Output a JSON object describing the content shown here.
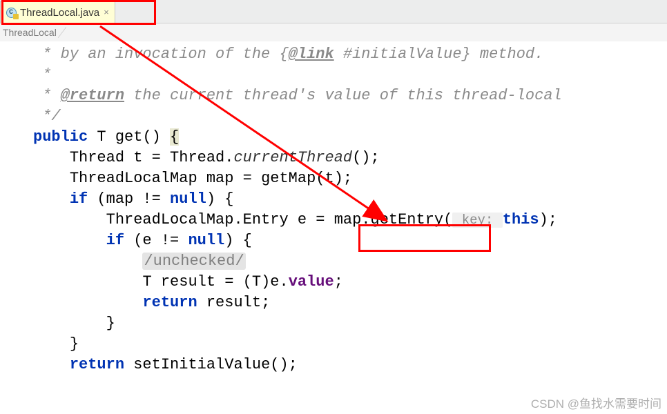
{
  "tab": {
    "icon_letter": "C",
    "filename": "ThreadLocal.java",
    "close_glyph": "×"
  },
  "breadcrumb": {
    "item1": "ThreadLocal"
  },
  "code": {
    "jd_line1_pre": " * by an invocation of the {",
    "jd_link_tag": "@link",
    "jd_line1_post": " #initialValue} method.",
    "jd_line2": " *",
    "jd_line3_pre": " * ",
    "jd_return_tag": "@return",
    "jd_line3_post": " the current thread's value of this thread-local",
    "jd_line4": " */",
    "kw_public": "public",
    "type_T": "T",
    "m_get": "get",
    "paren_empty": "()",
    "brace_open": "{",
    "type_Thread": "Thread",
    "var_t": "t",
    "eq": " = ",
    "Thread_dot": "Thread.",
    "m_currentThread": "currentThread",
    "call_end": "();",
    "type_ThreadLocalMap": "ThreadLocalMap",
    "var_map": "map",
    "m_getMap": "getMap",
    "call_t": "(t);",
    "kw_if": "if",
    "cond_map": " (map != ",
    "kw_null": "null",
    "close_brace_line": ") {",
    "type_Entry": "ThreadLocalMap.Entry",
    "var_e": "e",
    "map_dot": "map.",
    "m_getEntry": "getEntry",
    "paren_open": "(",
    "hint_key": " key: ",
    "kw_this": "this",
    "close_call": ");",
    "cond_e": " (e != ",
    "suppress": "/unchecked/",
    "var_result": "result",
    "cast": " = (T)e.",
    "field_value": "value",
    "semi": ";",
    "kw_return": "return",
    "ret_result": " result;",
    "brace_close": "}",
    "m_setInitialValue": "setInitialValue"
  },
  "watermark": "CSDN @鱼找水需要时间"
}
